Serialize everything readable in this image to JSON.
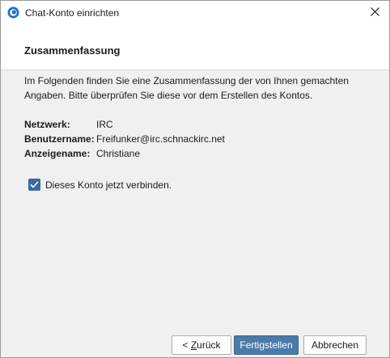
{
  "window": {
    "title": "Chat-Konto einrichten",
    "app_icon": "app-logo-icon",
    "close_icon": "close-icon"
  },
  "page": {
    "heading": "Zusammenfassung",
    "intro": "Im Folgenden finden Sie eine Zusammenfassung der von Ihnen gemachten Angaben. Bitte überprüfen Sie diese vor dem Erstellen des Kontos."
  },
  "summary": [
    {
      "label": "Netzwerk:",
      "value": "IRC"
    },
    {
      "label": "Benutzername:",
      "value": "Freifunker@irc.schnackirc.net"
    },
    {
      "label": "Anzeigename:",
      "value": "Christiane"
    }
  ],
  "connect": {
    "label": "Dieses Konto jetzt verbinden.",
    "checked": true
  },
  "buttons": {
    "back_prefix": "< ",
    "back_accel": "Z",
    "back_rest": "urück",
    "finish": "Fertigstellen",
    "cancel": "Abbrechen"
  },
  "colors": {
    "accent": "#3b6aa0",
    "primary_button": "#4a7aa8"
  }
}
